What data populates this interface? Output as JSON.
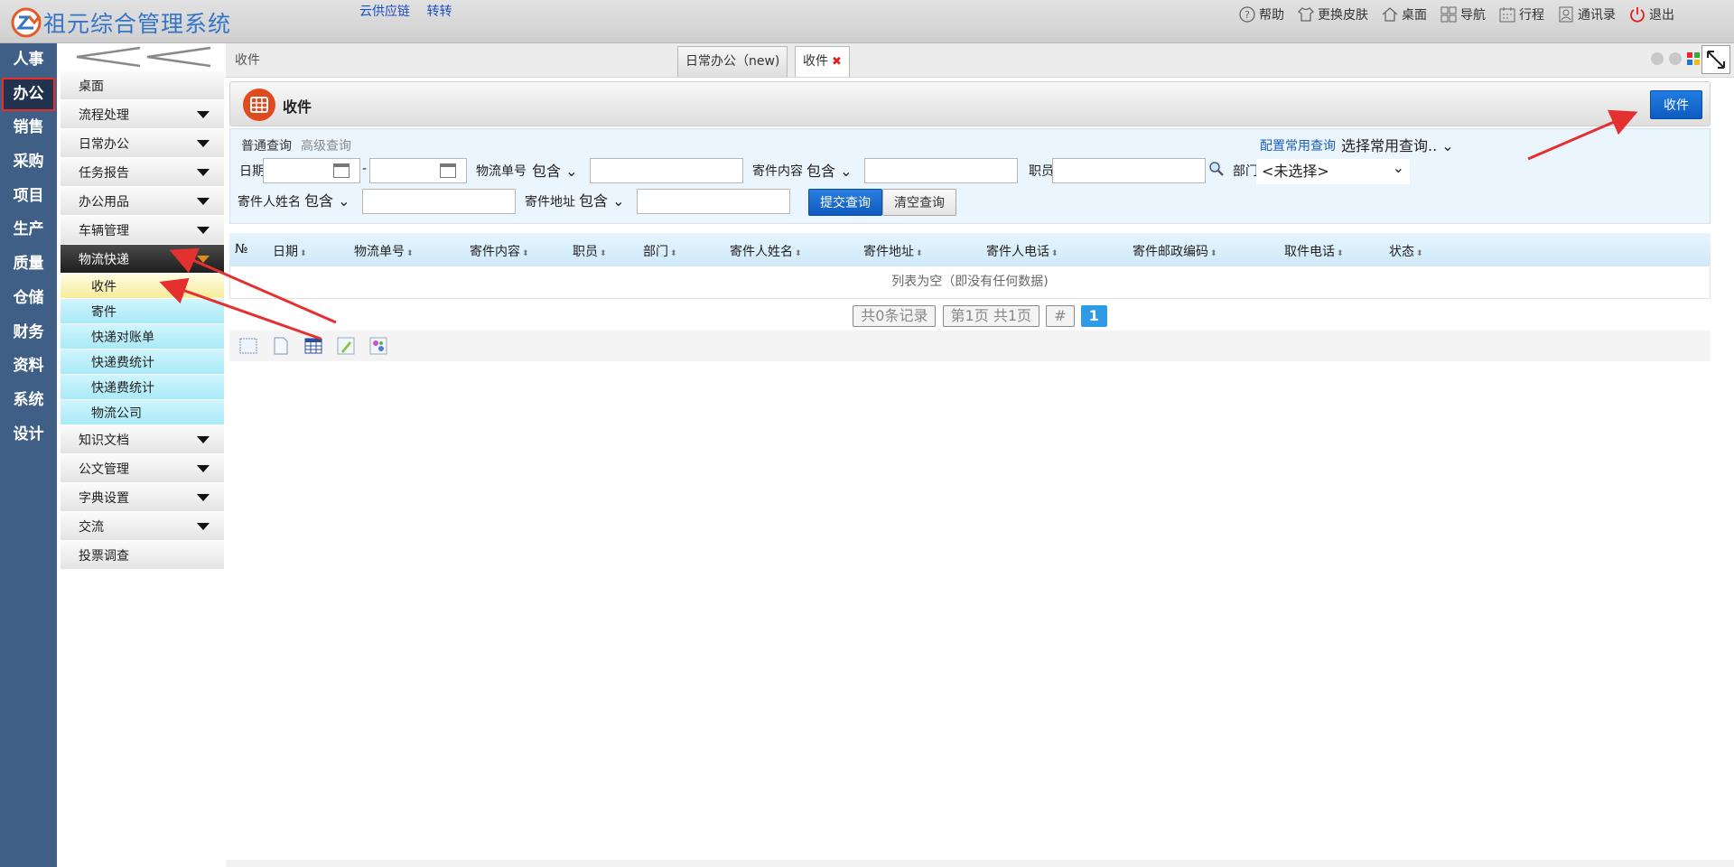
{
  "app": {
    "title": "祖元综合管理系统",
    "links": [
      "云供应链",
      "转转"
    ]
  },
  "topbar": {
    "items": [
      {
        "label": "帮助",
        "icon": "help-icon"
      },
      {
        "label": "更换皮肤",
        "icon": "shirt-icon"
      },
      {
        "label": "桌面",
        "icon": "home-icon"
      },
      {
        "label": "导航",
        "icon": "grid-icon"
      },
      {
        "label": "行程",
        "icon": "calendar-icon"
      },
      {
        "label": "通讯录",
        "icon": "contacts-icon"
      },
      {
        "label": "退出",
        "icon": "power-icon"
      }
    ]
  },
  "modules": [
    "人事",
    "办公",
    "销售",
    "采购",
    "项目",
    "生产",
    "质量",
    "仓储",
    "财务",
    "资料",
    "系统",
    "设计"
  ],
  "active_module": "办公",
  "sidebar": {
    "menus": [
      {
        "label": "桌面",
        "arrow": false
      },
      {
        "label": "流程处理",
        "arrow": true
      },
      {
        "label": "日常办公",
        "arrow": true
      },
      {
        "label": "任务报告",
        "arrow": true
      },
      {
        "label": "办公用品",
        "arrow": true
      },
      {
        "label": "车辆管理",
        "arrow": true
      },
      {
        "label": "物流快递",
        "arrow": true,
        "open": true
      },
      {
        "label": "知识文档",
        "arrow": true
      },
      {
        "label": "公文管理",
        "arrow": true
      },
      {
        "label": "字典设置",
        "arrow": true
      },
      {
        "label": "交流",
        "arrow": true
      },
      {
        "label": "投票调查",
        "arrow": false
      }
    ],
    "submenu": [
      "收件",
      "寄件",
      "快递对账单",
      "快递费统计",
      "快递费统计",
      "物流公司"
    ],
    "selected_sub": "收件"
  },
  "tabs": {
    "crumb": "收件",
    "items": [
      {
        "label": "日常办公（new)"
      },
      {
        "label": "收件",
        "closable": true
      }
    ]
  },
  "panel": {
    "title": "收件",
    "button": "收件"
  },
  "query": {
    "tabs": [
      "普通查询",
      "高级查询"
    ],
    "config_link": "配置常用查询",
    "common_select": "选择常用查询..",
    "labels": {
      "date": "日期",
      "dash": "-",
      "tracking": "物流单号",
      "content": "寄件内容",
      "staff": "职员",
      "dept": "部门",
      "sender": "寄件人姓名",
      "address": "寄件地址"
    },
    "contains": "包含",
    "dept_value": "<未选择>",
    "submit": "提交查询",
    "clear": "清空查询"
  },
  "grid": {
    "columns": [
      "№",
      "日期",
      "物流单号",
      "寄件内容",
      "职员",
      "部门",
      "寄件人姓名",
      "寄件地址",
      "寄件人电话",
      "寄件邮政编码",
      "取件电话",
      "状态"
    ],
    "empty": "列表为空（即没有任何数据)"
  },
  "pager": {
    "total": "共0条记录",
    "pages": "第1页 共1页",
    "hash": "#",
    "current": "1"
  },
  "tools": [
    "layout-icon",
    "page-icon",
    "table-icon",
    "edit-icon",
    "settings-icon"
  ],
  "colors": {
    "accent": "#0f5cc0",
    "module_bg": "#3f5f86",
    "annotation": "#e53030"
  }
}
